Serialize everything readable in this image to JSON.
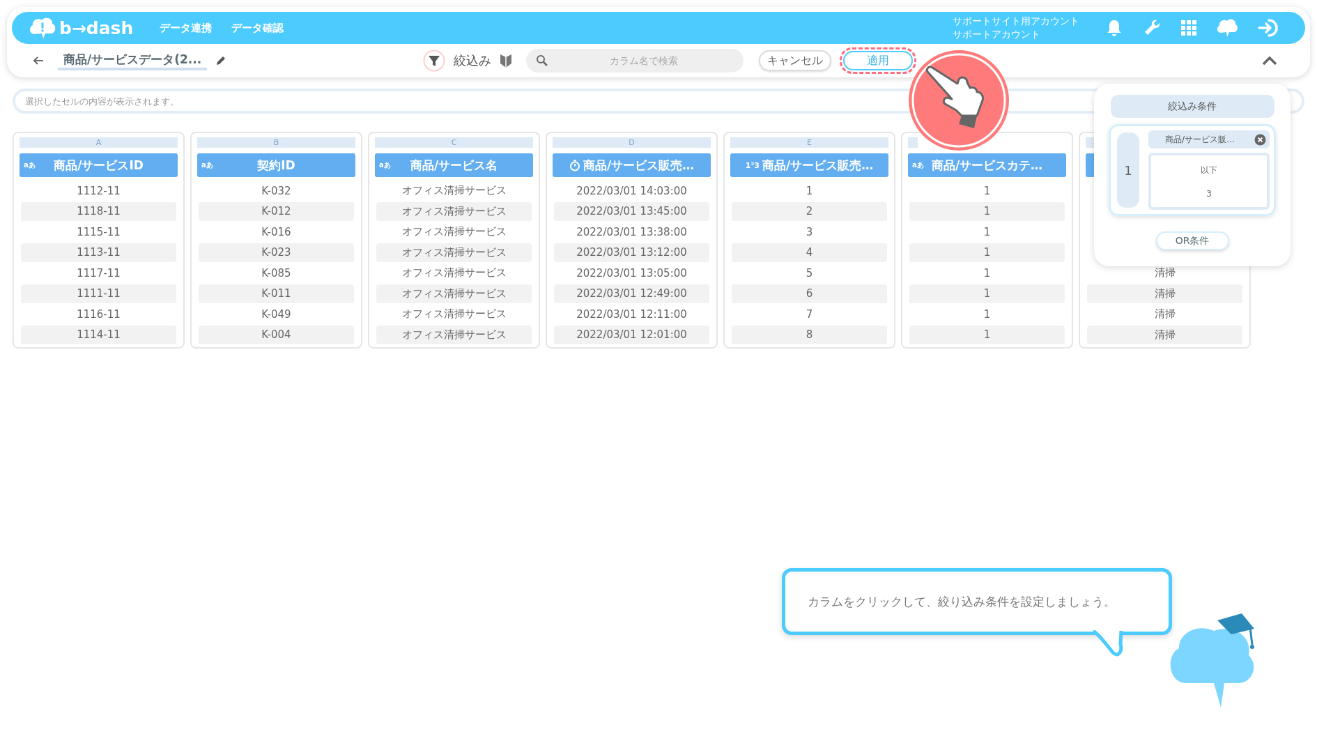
{
  "header": {
    "logo": "b→dash",
    "nav": [
      {
        "label": "データ連携"
      },
      {
        "label": "データ確認"
      }
    ],
    "account": [
      "サポートサイト用アカウント",
      "サポートアカウント"
    ]
  },
  "toolbar": {
    "title": "商品/サービスデータ(2...",
    "filter_label": "絞込み",
    "search": {
      "placeholder": "カラム名で検索"
    },
    "cancel": "キャンセル",
    "apply": "適用"
  },
  "cell_display": {
    "placeholder": "選択したセルの内容が表示されます。"
  },
  "table": {
    "columns": [
      {
        "letter": "A",
        "kind": "text",
        "type_label": "aあ",
        "header": "商品/サービスID",
        "cells": [
          "1112-11",
          "1118-11",
          "1115-11",
          "1113-11",
          "1117-11",
          "1111-11",
          "1116-11",
          "1114-11"
        ]
      },
      {
        "letter": "B",
        "kind": "text",
        "type_label": "aあ",
        "header": "契約ID",
        "cells": [
          "K-032",
          "K-012",
          "K-016",
          "K-023",
          "K-085",
          "K-011",
          "K-049",
          "K-004"
        ]
      },
      {
        "letter": "C",
        "kind": "text",
        "type_label": "aあ",
        "header": "商品/サービス名",
        "cells": [
          "オフィス清掃サービス",
          "オフィス清掃サービス",
          "オフィス清掃サービス",
          "オフィス清掃サービス",
          "オフィス清掃サービス",
          "オフィス清掃サービス",
          "オフィス清掃サービス",
          "オフィス清掃サービス"
        ]
      },
      {
        "letter": "D",
        "kind": "datetime",
        "header": "商品/サービス販売…",
        "cells": [
          "2022/03/01 14:03:00",
          "2022/03/01 13:45:00",
          "2022/03/01 13:38:00",
          "2022/03/01 13:12:00",
          "2022/03/01 13:05:00",
          "2022/03/01 12:49:00",
          "2022/03/01 12:11:00",
          "2022/03/01 12:01:00"
        ]
      },
      {
        "letter": "E",
        "kind": "number",
        "type_label": "1²3",
        "header": "商品/サービス販売…",
        "cells": [
          "1",
          "2",
          "3",
          "4",
          "5",
          "6",
          "7",
          "8"
        ]
      },
      {
        "kind": "text",
        "type_label": "aあ",
        "header": "商品/サービスカテ…",
        "cells": [
          "1",
          "1",
          "1",
          "1",
          "1",
          "1",
          "1",
          "1"
        ]
      },
      {
        "kind": "text",
        "cells_below_panel": [
          "清掃",
          "清掃",
          "清掃",
          "清掃"
        ]
      }
    ]
  },
  "filter_panel": {
    "title": "絞込み条件",
    "groups": [
      {
        "number": "1",
        "conditions": [
          {
            "column": "商品/サービス販…",
            "operator": "以下",
            "value": "3"
          }
        ]
      }
    ],
    "or_button": "OR条件"
  },
  "tutorial": {
    "message": "カラムをクリックして、絞り込み条件を設定しましょう。"
  }
}
